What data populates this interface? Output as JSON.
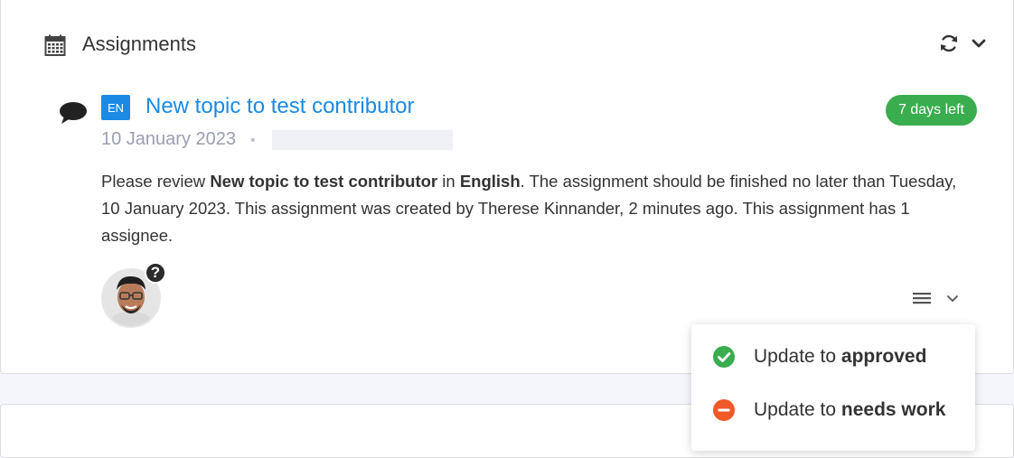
{
  "header": {
    "title": "Assignments",
    "icon": "calendar-icon"
  },
  "assignment": {
    "language_code": "EN",
    "topic_title": "New topic to test contributor",
    "due_badge": "7 days left",
    "due_badge_color": "#3aad4f",
    "date": "10 January 2023",
    "separator": "•",
    "description": {
      "part1": "Please review ",
      "topic": "New topic to test contributor",
      "part2": " in ",
      "language": "English",
      "part3": ". The assignment should be finished no later than Tuesday, 10 January 2023. This assignment was created by Therese Kinnander, 2 minutes ago. This assignment has 1 assignee."
    },
    "assignee_status_badge": "?"
  },
  "dropdown": {
    "items": [
      {
        "prefix": "Update to ",
        "action": "approved",
        "icon": "check-circle-icon",
        "color": "#3aad4f"
      },
      {
        "prefix": "Update to ",
        "action": "needs work",
        "icon": "minus-circle-icon",
        "color": "#f05a28"
      }
    ]
  },
  "colors": {
    "link": "#1a8ae5",
    "language_badge": "#1a8ae5"
  }
}
